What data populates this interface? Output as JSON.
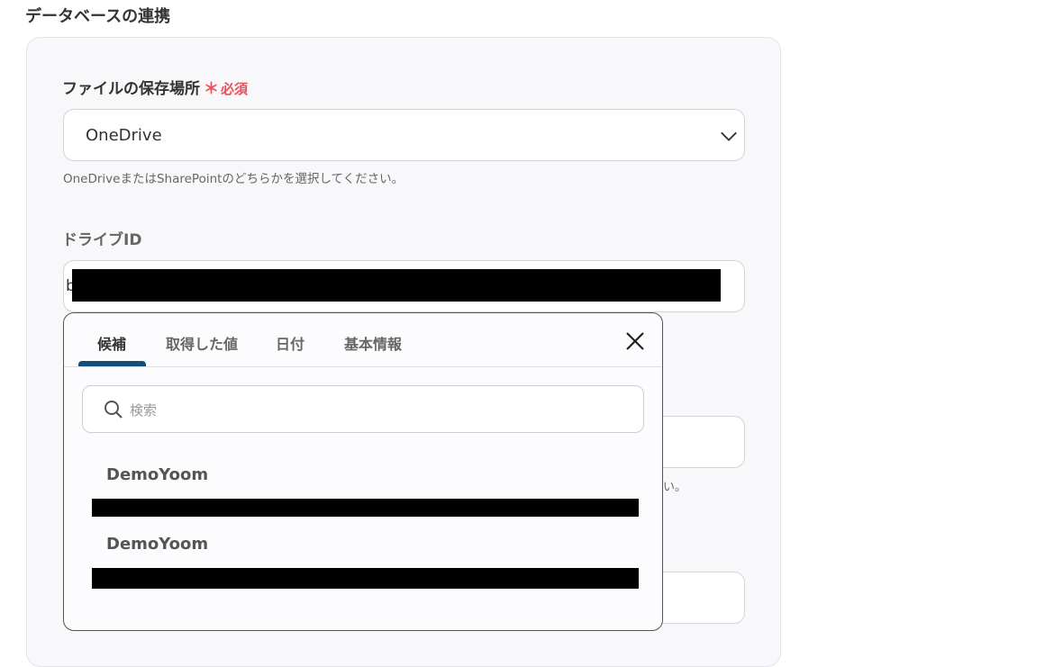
{
  "section": {
    "title": "データベースの連携"
  },
  "storage": {
    "label": "ファイルの保存場所",
    "required_mark": "＊",
    "required_text": "必須",
    "value": "OneDrive",
    "help": "OneDriveまたはSharePointのどちらかを選択してください。"
  },
  "drive": {
    "label": "ドライブID",
    "value_prefix": "b"
  },
  "behind_help_tail": "い。",
  "popup": {
    "tabs": [
      {
        "label": "候補"
      },
      {
        "label": "取得した値"
      },
      {
        "label": "日付"
      },
      {
        "label": "基本情報"
      }
    ],
    "search_placeholder": "検索",
    "items": [
      {
        "name": "DemoYoom"
      },
      {
        "name": "DemoYoom"
      }
    ]
  },
  "colors": {
    "accent": "#135079",
    "required": "#e8515a"
  }
}
